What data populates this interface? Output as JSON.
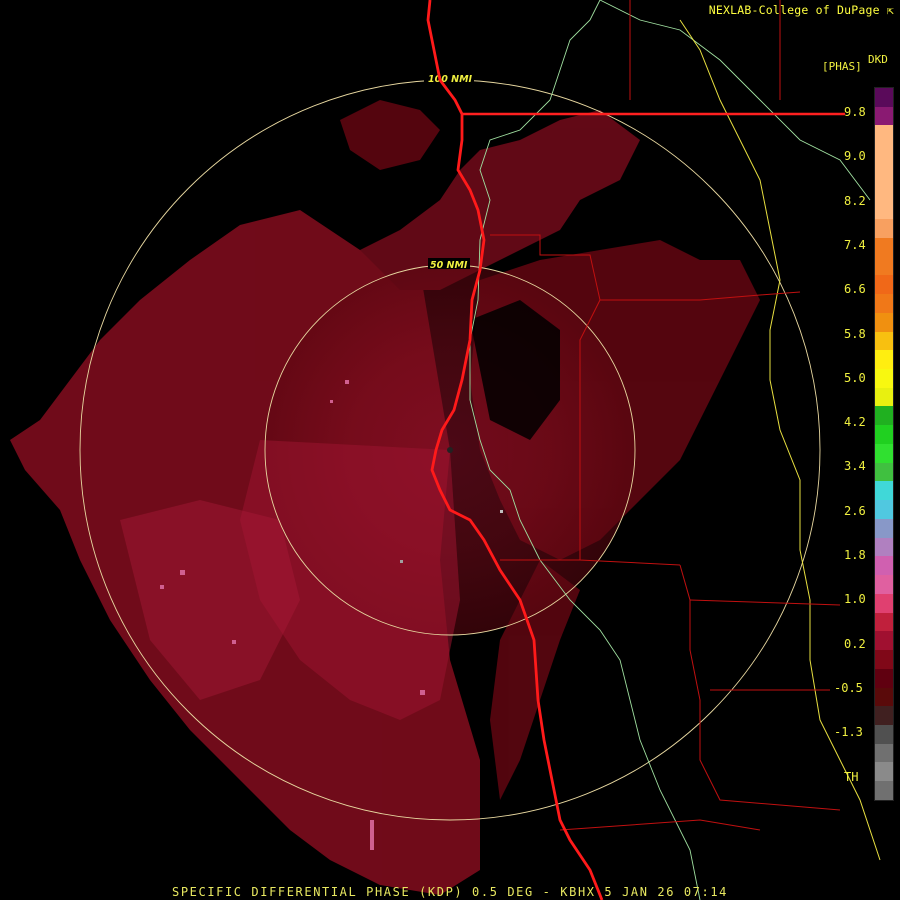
{
  "credit": "NEXLAB-College of DuPage",
  "credit_icon": "cursor-arrow-icon",
  "legend": {
    "product_code": "DKD",
    "unit": "[PHAS]",
    "ticks": [
      "9.8",
      "9.0",
      "8.2",
      "7.4",
      "6.6",
      "5.8",
      "5.0",
      "4.2",
      "3.4",
      "2.6",
      "1.8",
      "1.0",
      "0.2",
      "-0.5",
      "-1.3",
      "TH"
    ],
    "colors": [
      "#5a0a5a",
      "#8a1a72",
      "#ffb880",
      "#ffb880",
      "#ffb880",
      "#ffb880",
      "#ffb880",
      "#f8a060",
      "#f07a20",
      "#f07a20",
      "#f06818",
      "#f07818",
      "#f09010",
      "#f8c010",
      "#ffee10",
      "#f8f810",
      "#e8f010",
      "#20b020",
      "#20d020",
      "#30e030",
      "#40c040",
      "#40d8d8",
      "#50c8e0",
      "#8898c8",
      "#b080c0",
      "#d060b0",
      "#e060a0",
      "#e04070",
      "#c0203c",
      "#a01030",
      "#800818",
      "#600010",
      "#5a0a0a",
      "#402020",
      "#505050",
      "#707070",
      "#8a8a8a",
      "#707070"
    ]
  },
  "rings": [
    {
      "label": "100 NMI"
    },
    {
      "label": "50 NMI"
    }
  ],
  "colors": {
    "echo_dark": "#5c0610",
    "echo_mid": "#7a0c1c",
    "echo_light": "#b01840",
    "echo_speckle": "#d06090",
    "coast": "#ff2020",
    "state_line": "#ff2020",
    "county_line": "#c01010",
    "river": "#a0e0a0",
    "yellow_line": "#e8e040",
    "ring": "#e8d8a0"
  },
  "footer": "SPECIFIC DIFFERENTIAL PHASE (KDP) 0.5 DEG - KBHX 5 JAN 26 07:14"
}
